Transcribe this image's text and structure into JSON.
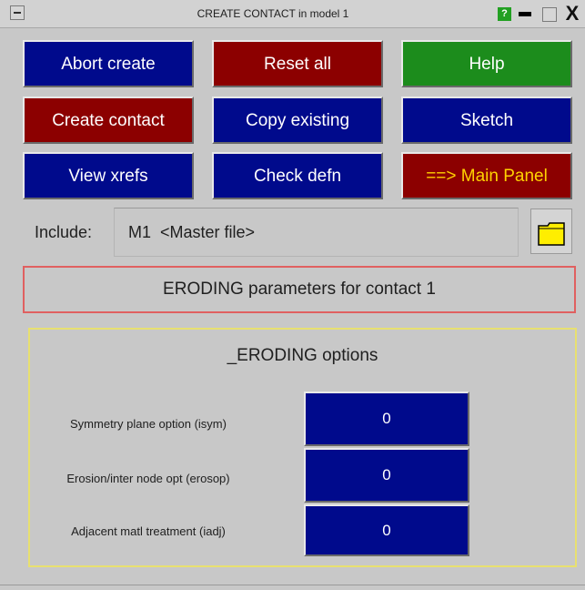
{
  "window": {
    "title": "CREATE CONTACT in model 1",
    "help_icon_text": "?",
    "close_text": "X"
  },
  "buttons": {
    "abort_create": "Abort create",
    "reset_all": "Reset all",
    "help": "Help",
    "create_contact": "Create contact",
    "copy_existing": "Copy existing",
    "sketch": "Sketch",
    "view_xrefs": "View xrefs",
    "check_defn": "Check defn",
    "main_panel": "==> Main Panel"
  },
  "include": {
    "label": "Include:",
    "value": "M1  <Master file>"
  },
  "eroding": {
    "header": "ERODING parameters for contact 1",
    "options_title": "_ERODING options",
    "options": [
      {
        "label": "Symmetry plane option     (isym)",
        "value": "0"
      },
      {
        "label": "Erosion/inter node opt  (erosop)",
        "value": "0"
      },
      {
        "label": "Adjacent matl treatment     (iadj)",
        "value": "0"
      }
    ]
  },
  "colors": {
    "blue_button": "#000a8c",
    "red_button": "#8c0000",
    "green_button": "#1c8c1c",
    "main_panel_text": "#ffd200",
    "panel_bg": "#c8c8c8",
    "header_border": "#e06060",
    "options_border": "#e8e070",
    "folder": "#ffee00"
  },
  "icons": [
    "window-menu-icon",
    "help-icon",
    "minimize-icon",
    "restore-icon",
    "close-icon",
    "folder-icon"
  ]
}
